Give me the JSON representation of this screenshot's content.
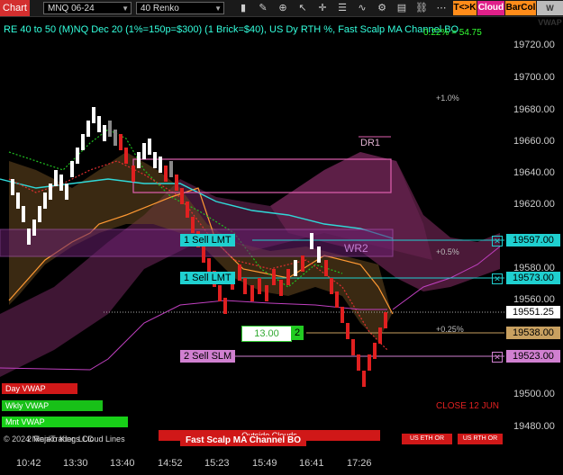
{
  "toolbar": {
    "chart_label": "Chart",
    "instrument": "MNQ 06-24",
    "bar_type": "40 Renko",
    "btn_tk": "T<>K",
    "btn_cloud": "Cloud",
    "btn_barcol": "BarCol",
    "btn_vwap": "W VWAP"
  },
  "chart": {
    "title": "RE 40 to 50 (M)NQ Dec 20 (1%=150p=$300) (1 Brick=$40), US Dy RTH %, Fast Scalp MA Channel BO",
    "pct_text": "0.22% = 54.75",
    "dr1": "DR1",
    "wr2": "WR2",
    "pct_1": "+1.0%",
    "pct_05": "+0.5%",
    "pct_025": "+0.25%",
    "close_label": "CLOSE 12 JUN",
    "copyright": "© 2024 NinjaTrader, LLC",
    "renko_lines": "2 Renko Kings Cloud Lines",
    "day_vwap": "Day VWAP",
    "wkly_vwap": "Wkly VWAP",
    "mnt_vwap": "Mnt VWAP",
    "outside_clouds": "Outside Clouds",
    "fast_scalp": "Fast Scalp MA Channel BO",
    "us_eth_or": "US ETH OR",
    "us_rth_or": "US RTH OR"
  },
  "orders": {
    "sell_lmt_1": "1 Sell LMT",
    "sell_lmt_2": "1 Sell LMT",
    "sell_slm": "2 Sell SLM",
    "qty_value": "13.00",
    "qty_count": "2"
  },
  "price_tags": {
    "p1": "19597.00",
    "p2": "19573.00",
    "p3": "19551.25",
    "p4": "19538.00",
    "p5": "19523.00"
  },
  "yaxis_labels": [
    "19720.00",
    "19700.00",
    "19680.00",
    "19660.00",
    "19640.00",
    "19620.00",
    "19580.00",
    "19560.00",
    "19500.00",
    "19480.00"
  ],
  "xaxis_labels": [
    "10:42",
    "13:30",
    "13:40",
    "14:52",
    "15:23",
    "15:49",
    "16:41",
    "17:26"
  ],
  "colors": {
    "cyan": "#1fd0d0",
    "pink": "#d080d0",
    "orange": "#ff9933",
    "red": "#e02020",
    "gold": "#c8a060"
  }
}
